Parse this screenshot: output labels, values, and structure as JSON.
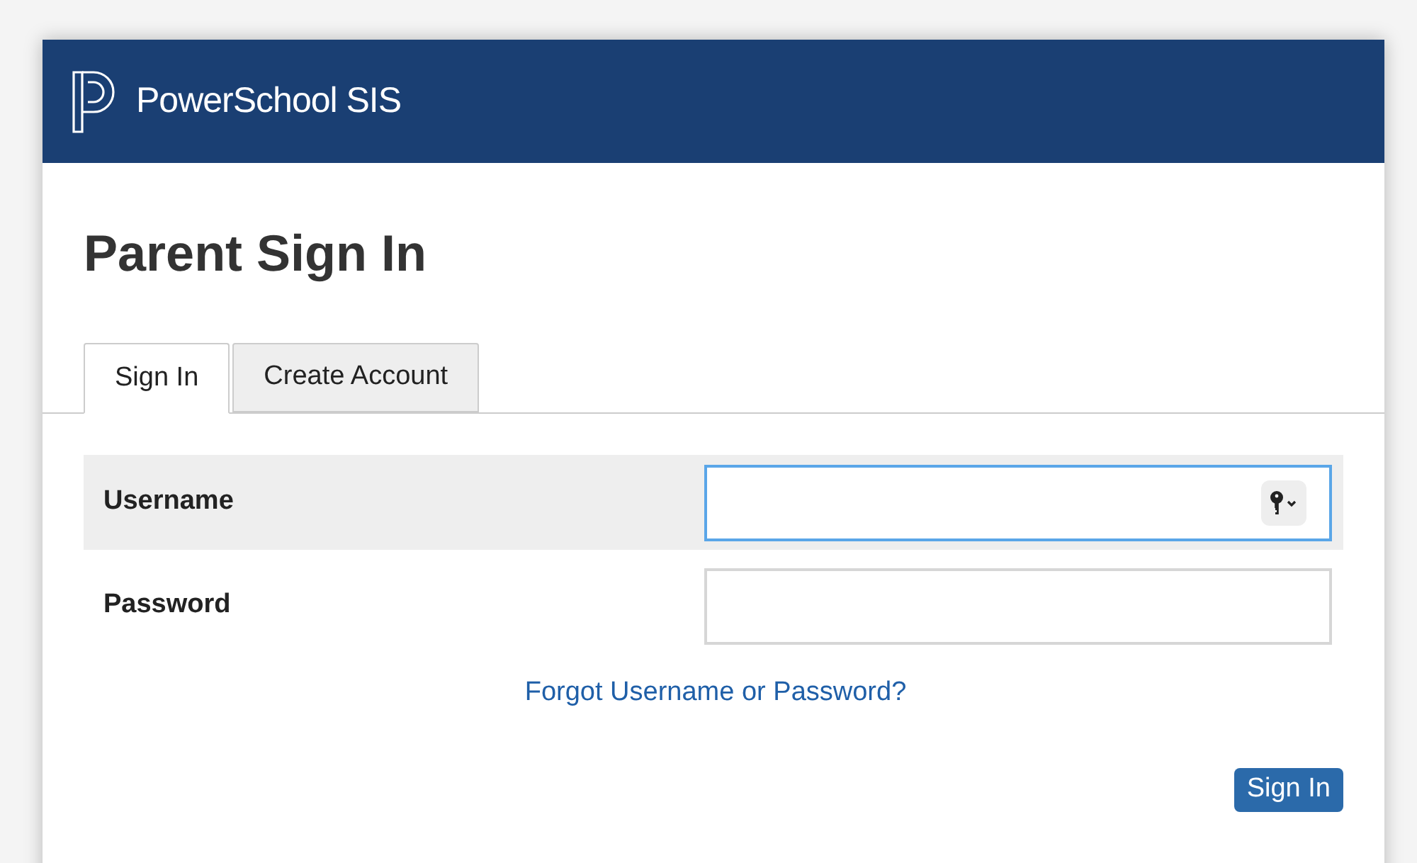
{
  "header": {
    "brand": "PowerSchool SIS"
  },
  "page_title": "Parent Sign In",
  "tabs": [
    {
      "label": "Sign In",
      "selected": true
    },
    {
      "label": "Create Account",
      "selected": false
    }
  ],
  "fields": [
    {
      "label": "Username",
      "focused": true,
      "highlighted": true,
      "autofill_key": true
    },
    {
      "label": "Password",
      "focused": false,
      "highlighted": false,
      "autofill_key": false
    }
  ],
  "forgot_link": "Forgot Username or Password?",
  "submit_button": "Sign In"
}
